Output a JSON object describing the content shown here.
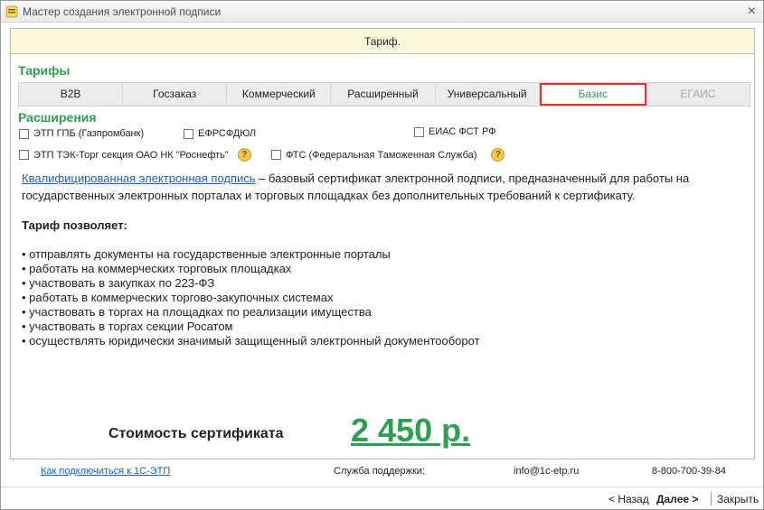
{
  "window": {
    "title": "Мастер создания электронной подписи",
    "close_glyph": "×"
  },
  "banner": {
    "text": "Тариф."
  },
  "tariffs": {
    "title": "Тарифы",
    "tabs": [
      {
        "label": "B2B"
      },
      {
        "label": "Госзаказ"
      },
      {
        "label": "Коммерческий"
      },
      {
        "label": "Расширенный"
      },
      {
        "label": "Универсальный"
      },
      {
        "label": "Базис"
      },
      {
        "label": "ЕГАИС"
      }
    ],
    "selected": "Базис"
  },
  "extensions": {
    "title": "Расширения",
    "items": [
      {
        "label": "ЭТП ГПБ (Газпромбанк)",
        "checked": false
      },
      {
        "label": "ЕФРСФДЮЛ",
        "checked": false
      },
      {
        "label": "ЕИАС ФСТ РФ",
        "checked": false
      },
      {
        "label": "ЭТП ТЭК-Торг секция ОАО НК \"Роснефть\"",
        "checked": false
      },
      {
        "label": "ФТС (Федеральная Таможенная Служба)",
        "checked": false
      }
    ],
    "help_glyph": "?"
  },
  "description": {
    "link": "Квалифицированная электронная подпись",
    "text": " – базовый сертификат электронной подписи, предназначенный для работы на государственных электронных порталах и торговых площадках без дополнительных требований к сертификату."
  },
  "allows": {
    "title": "Тариф позволяет:",
    "items": [
      "• отправлять документы на государственные электронные порталы",
      "• работать на коммерческих торговых площадках",
      "• участвовать в закупках по 223-ФЗ",
      "• работать в коммерческих торгово-закупочных системах",
      "• участвовать в торгах на площадках по реализации имущества",
      "• участвовать в торгах секции Росатом",
      "• осуществлять юридически значимый защищенный электронный документооборот"
    ]
  },
  "price": {
    "label": "Стоимость сертификата",
    "value": "2 450 р."
  },
  "footer": {
    "connect_link": "Как подключиться к 1С-ЭТП",
    "support_label": "Служба поддержки:",
    "email": "info@1c-etp.ru",
    "phone": "8-800-700-39-84"
  },
  "nav": {
    "back": "< Назад",
    "next": "Далее >",
    "close": "Закрыть"
  },
  "colors": {
    "accent_green": "#2e9f52",
    "link_blue": "#1f5fb5",
    "selection_red": "#e03131",
    "banner_bg": "#fbf8dc"
  }
}
